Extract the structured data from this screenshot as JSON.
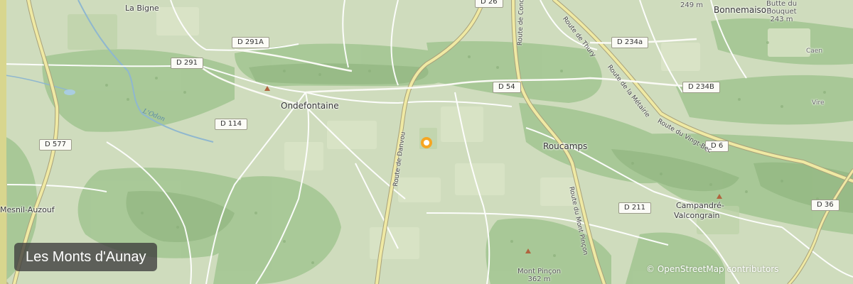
{
  "map": {
    "title": "Les Monts d'Aunay",
    "attribution": {
      "copyright": "©",
      "link_text": "OpenStreetMap",
      "suffix": "contributors"
    },
    "places": {
      "la_bigne": "La Bigne",
      "ondefontaine": "Ondefontaine",
      "roucamps": "Roucamps",
      "bonnemaison": "Bonnemaison",
      "campandre_1": "Campandré-",
      "campandre_2": "Valcongrain",
      "mesnil_auzouf": "Mesnil-Auzouf",
      "caen": "Caen",
      "vire": "Vire"
    },
    "peaks": {
      "butte_name_1": "Butte du",
      "butte_name_2": "Bouquet",
      "butte_elev": "243 m",
      "top_elev": "249 m",
      "mont_pincon_name": "Mont Pinçon",
      "mont_pincon_elev": "362 m"
    },
    "road_refs": {
      "d26": "D 26",
      "d291a": "D 291A",
      "d291": "D 291",
      "d114": "D 114",
      "d577": "D 577",
      "d54": "D 54",
      "d234a": "D 234a",
      "d234b": "D 234B",
      "d6": "D 6",
      "d211": "D 211",
      "d36": "D 36"
    },
    "road_names": {
      "route_danvou": "Route de Danvou",
      "route_conde": "Route de Condé",
      "route_thury": "Route de Thury",
      "route_metairie": "Route de la Métairie",
      "route_vingt_bec": "Route du Vingt-Bec",
      "route_mont_pincon": "Route du Mont Pinçon"
    },
    "rivers": {
      "odon": "L'Odon"
    },
    "colors": {
      "land": "#cfdcbd",
      "forest": "#a9c89a",
      "dark_forest": "#8fb27f",
      "road_major": "#f4f0a8",
      "road_minor": "#ffffff",
      "marker": "#f5a623"
    },
    "marker_icon": "location-marker-icon"
  }
}
